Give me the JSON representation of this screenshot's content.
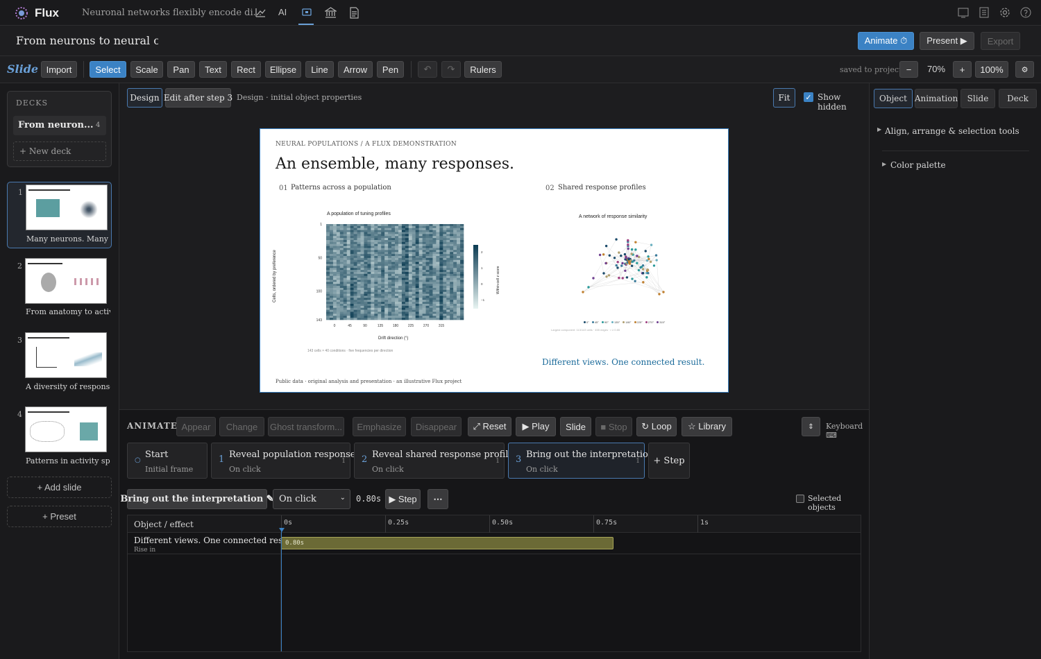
{
  "topbar": {
    "app_name": "Flux",
    "doc_title": "Neuronal networks flexibly encode di...",
    "tool_icons": [
      "chart-icon",
      "ai-icon",
      "slides-icon",
      "institution-icon",
      "document-icon"
    ],
    "ai_label": "AI",
    "right_icons": [
      "panel-icon",
      "pages-icon",
      "gear-icon",
      "help-icon"
    ]
  },
  "titlebar": {
    "title": "From neurons to neural code",
    "animate_label": "Animate ⏱",
    "present_label": "Present ▶",
    "export_label": "Export"
  },
  "toolbar": {
    "brand": "Slide",
    "import": "Import",
    "tools": [
      "Select",
      "Scale",
      "Pan",
      "Text",
      "Rect",
      "Ellipse",
      "Line",
      "Arrow",
      "Pen"
    ],
    "undo": "↶",
    "redo": "↷",
    "rulers": "Rulers",
    "saved": "saved to project",
    "zoom_out": "−",
    "zoom": "70%",
    "zoom_in": "+",
    "zoom_full": "100%",
    "settings": "⚙"
  },
  "decks": {
    "header": "DECKS",
    "deck_name": "From neuron...",
    "deck_count": "4",
    "new_deck": "+ New deck"
  },
  "slides": [
    {
      "num": "1",
      "label": "Many neurons. Many ..."
    },
    {
      "num": "2",
      "label": "From anatomy to activ..."
    },
    {
      "num": "3",
      "label": "A diversity of responses"
    },
    {
      "num": "4",
      "label": "Patterns in activity sp..."
    }
  ],
  "left_buttons": {
    "add_slide": "+ Add slide",
    "preset": "+ Preset"
  },
  "canvas": {
    "design_tab": "Design",
    "edit_tab": "Edit after step 3",
    "status": "Design · initial object properties",
    "fit": "Fit",
    "show_hidden": "Show hidden"
  },
  "slide": {
    "kicker": "NEURAL POPULATIONS / A FLUX DEMONSTRATION",
    "title": "An ensemble, many responses.",
    "panel1_num": "01",
    "panel1_title": "Patterns across a population",
    "panel2_num": "02",
    "panel2_title": "Shared response profiles",
    "takeaway": "Different views. One connected result.",
    "footer": "Public data · original analysis and presentation · an illustrative Flux project"
  },
  "chart_data": [
    {
      "type": "heatmap",
      "title": "A population of tuning profiles",
      "xlabel": "Drift direction (°)",
      "ylabel": "Cells, ordered by preference",
      "x_ticks": [
        "0",
        "45",
        "90",
        "135",
        "180",
        "225",
        "270",
        "315"
      ],
      "y_ticks": [
        "1",
        "50",
        "100",
        "143"
      ],
      "colorbar_label": "Within-cell z score",
      "colorbar_ticks": [
        "2",
        "1",
        "0",
        "−1"
      ],
      "caption": "143 cells × 40 conditions · five frequencies per direction",
      "colors": [
        "#e8f4f2",
        "#0b3b52"
      ]
    },
    {
      "type": "scatter",
      "title": "A network of response similarity",
      "legend": [
        "0°",
        "45°",
        "90°",
        "135°",
        "180°",
        "225°",
        "270°",
        "315°"
      ],
      "legend_colors": [
        "#1a4a6a",
        "#3a7a9a",
        "#2a9a9a",
        "#6ab0c0",
        "#b0a070",
        "#c08030",
        "#a04080",
        "#704090"
      ],
      "caption": "Largest component: 113/143 cells · 455 edges · r ≥ 0.85"
    }
  ],
  "right": {
    "tabs": [
      "Object",
      "Animation",
      "Slide",
      "Deck"
    ],
    "section1": "Align, arrange & selection tools",
    "section2": "Color palette"
  },
  "animate": {
    "label": "ANIMATE",
    "buttons": [
      "Appear",
      "Change",
      "Ghost transform...",
      "Emphasize",
      "Disappear"
    ],
    "reset": "⤢ Reset",
    "play": "▶ Play",
    "slide": "Slide",
    "stop": "■ Stop",
    "loop": "↻ Loop",
    "library": "☆ Library",
    "keyboard": "Keyboard ⌨",
    "steps": [
      {
        "num": "○",
        "title": "Start",
        "sub": "Initial frame",
        "count": ""
      },
      {
        "num": "1",
        "title": "Reveal population responses",
        "sub": "On click",
        "count": "1"
      },
      {
        "num": "2",
        "title": "Reveal shared response profiles",
        "sub": "On click",
        "count": "1"
      },
      {
        "num": "3",
        "title": "Bring out the interpretation",
        "sub": "On click",
        "count": "1"
      }
    ],
    "add_step": "+ Step",
    "step_name": "Bring out the interpretation ✎",
    "trigger": "On click",
    "duration": "0.80s",
    "step_btn": "▶ Step",
    "more": "⋯",
    "selected_objects": "Selected objects",
    "timeline_header": "Object / effect",
    "ticks": [
      "0s",
      "0.25s",
      "0.50s",
      "0.75s",
      "1s"
    ],
    "row_title": "Different views. One connected result.",
    "row_effect": "Rise in",
    "bar_label": "0.80s"
  }
}
